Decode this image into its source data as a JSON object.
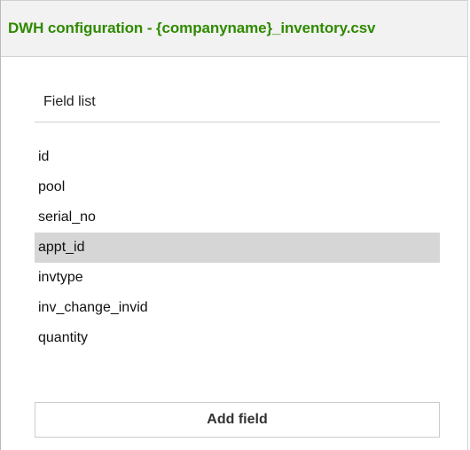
{
  "panel": {
    "title": "DWH configuration - {companyname}_inventory.csv"
  },
  "field_list": {
    "heading": "Field list",
    "selected_index": 3,
    "items": [
      {
        "label": "id"
      },
      {
        "label": "pool"
      },
      {
        "label": "serial_no"
      },
      {
        "label": "appt_id"
      },
      {
        "label": "invtype"
      },
      {
        "label": "inv_change_invid"
      },
      {
        "label": "quantity"
      }
    ],
    "add_button_label": "Add field"
  },
  "colors": {
    "title_green": "#2f8a00",
    "selected_row": "#d6d6d6",
    "header_bg": "#f2f2f2"
  }
}
